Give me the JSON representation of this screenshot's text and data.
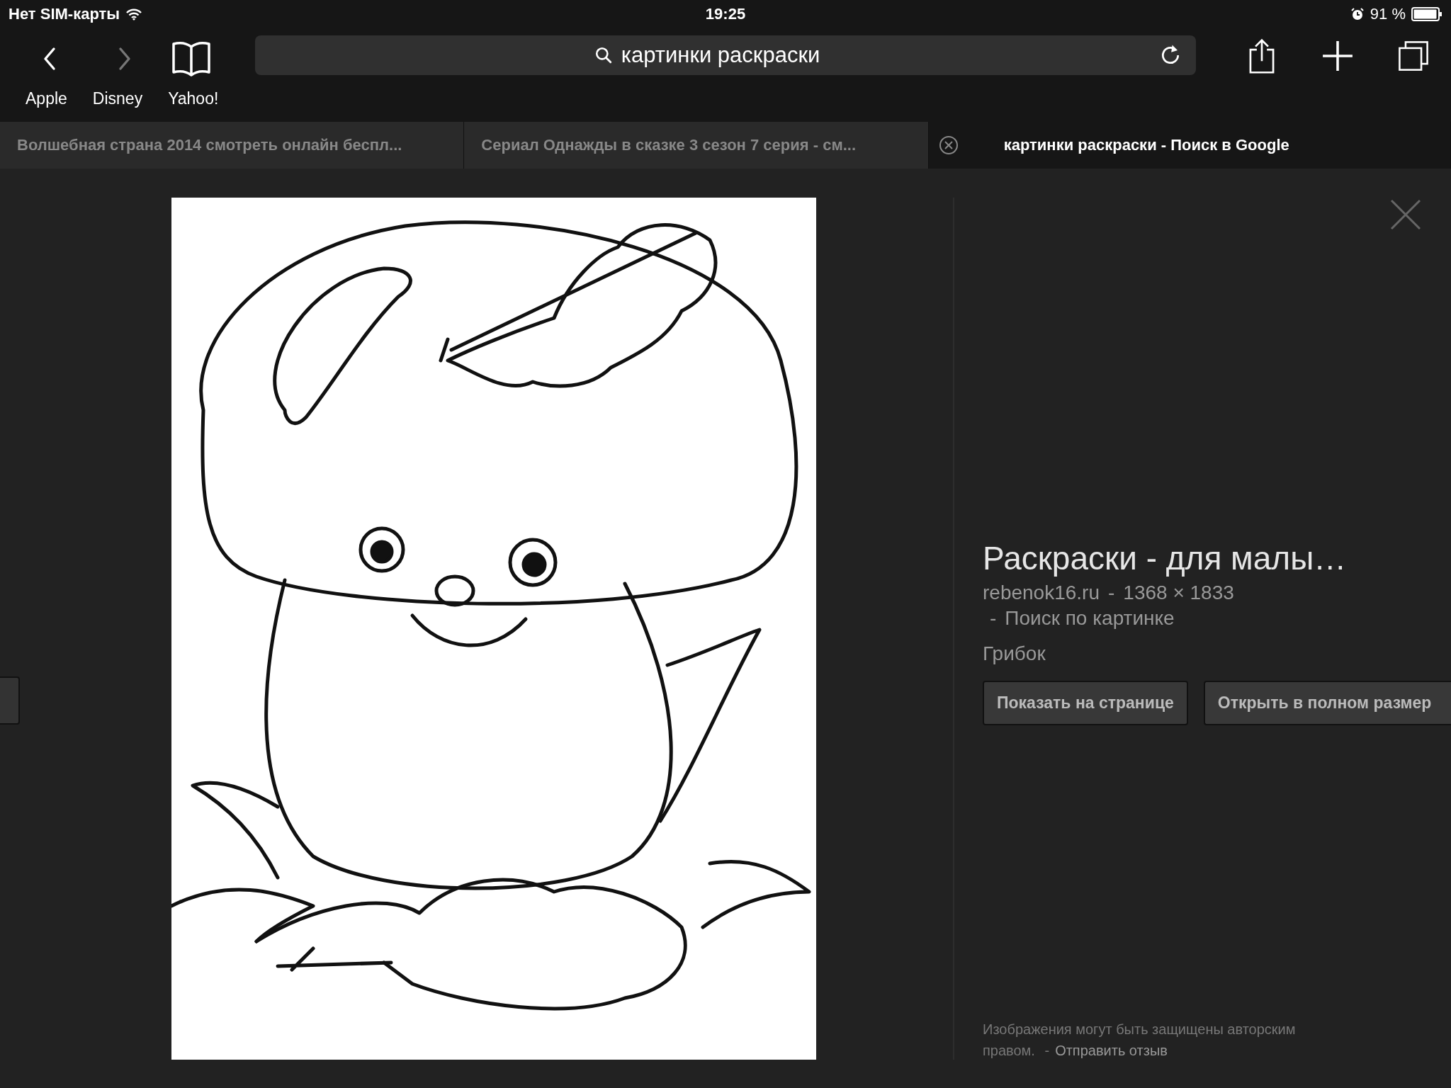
{
  "status_bar": {
    "carrier": "Нет SIM-карты",
    "time": "19:25",
    "battery": "91 %"
  },
  "nav_buttons": [
    {
      "kind": "back",
      "disabled": false
    },
    {
      "kind": "forward",
      "disabled": true
    }
  ],
  "bookmarks": [
    "Apple",
    "Disney",
    "Yahoo!"
  ],
  "address_bar": {
    "value": "картинки раскраски"
  },
  "tabs": [
    {
      "title": "Волшебная страна 2014 смотреть онлайн беспл...",
      "selected": false
    },
    {
      "title": "Сериал Однажды в сказке 3 сезон 7 серия - см...",
      "selected": false
    },
    {
      "title": "картинки раскраски - Поиск в Google",
      "selected": true
    }
  ],
  "image_panel": {
    "title": "Раскраски - для малы…",
    "source": "rebenok16.ru",
    "source_separator": "-",
    "link_separator": "-",
    "footer_separator": "-",
    "dimensions": "1368 × 1833",
    "search_link": "Поиск по картинке",
    "caption": "Грибок",
    "buttons": [
      "Показать на странице",
      "Открыть в полном размер"
    ],
    "footer_text": "Изображения могут быть защищены авторским правом.",
    "feedback_link": "Отправить отзыв"
  }
}
